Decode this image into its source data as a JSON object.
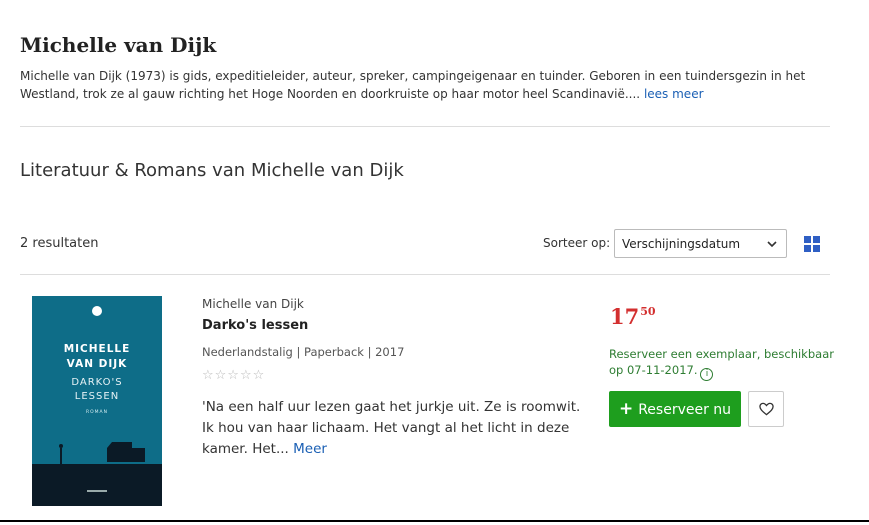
{
  "author": {
    "name": "Michelle van Dijk",
    "bio": "Michelle van Dijk (1973) is gids, expeditieleider, auteur, spreker, campingeigenaar en tuinder. Geboren in een tuindersgezin in het Westland, trok ze al gauw richting het Hoge Noorden en doorkruiste op haar motor heel Scandinavië....",
    "read_more": "lees meer"
  },
  "section": {
    "title": "Literatuur & Romans van Michelle van Dijk"
  },
  "results": {
    "count_label": "2 resultaten",
    "sort_label": "Sorteer op:",
    "sort_value": "Verschijningsdatum"
  },
  "product": {
    "cover": {
      "author_line1": "MICHELLE",
      "author_line2": "VAN DIJK",
      "title_line1": "DARKO'S",
      "title_line2": "LESSEN",
      "genre": "ROMAN"
    },
    "author": "Michelle van Dijk",
    "title": "Darko's lessen",
    "meta": "Nederlandstalig | Paperback | 2017",
    "stars": "☆☆☆☆☆",
    "rating": 0,
    "description": "'Na een half uur lezen gaat het jurkje uit. Ze is roomwit. Ik hou van haar lichaam. Het vangt al het licht in deze kamer. Het...",
    "more": "Meer",
    "price_whole": "17",
    "price_cents": "50",
    "availability": "Reserveer een exemplaar, beschikbaar op 07-11-2017.",
    "info_glyph": "i",
    "reserve_label": "Reserveer nu",
    "reserve_icon": "+"
  },
  "colors": {
    "link": "#1a5fb4",
    "price": "#d32f2f",
    "availability": "#2e7d32",
    "reserve_button": "#1e9e1e",
    "cover": "#0e6d88"
  },
  "icons": {
    "sort": "chevron-down-icon",
    "view": "grid-view-icon",
    "wishlist": "heart-icon",
    "info": "info-icon"
  }
}
